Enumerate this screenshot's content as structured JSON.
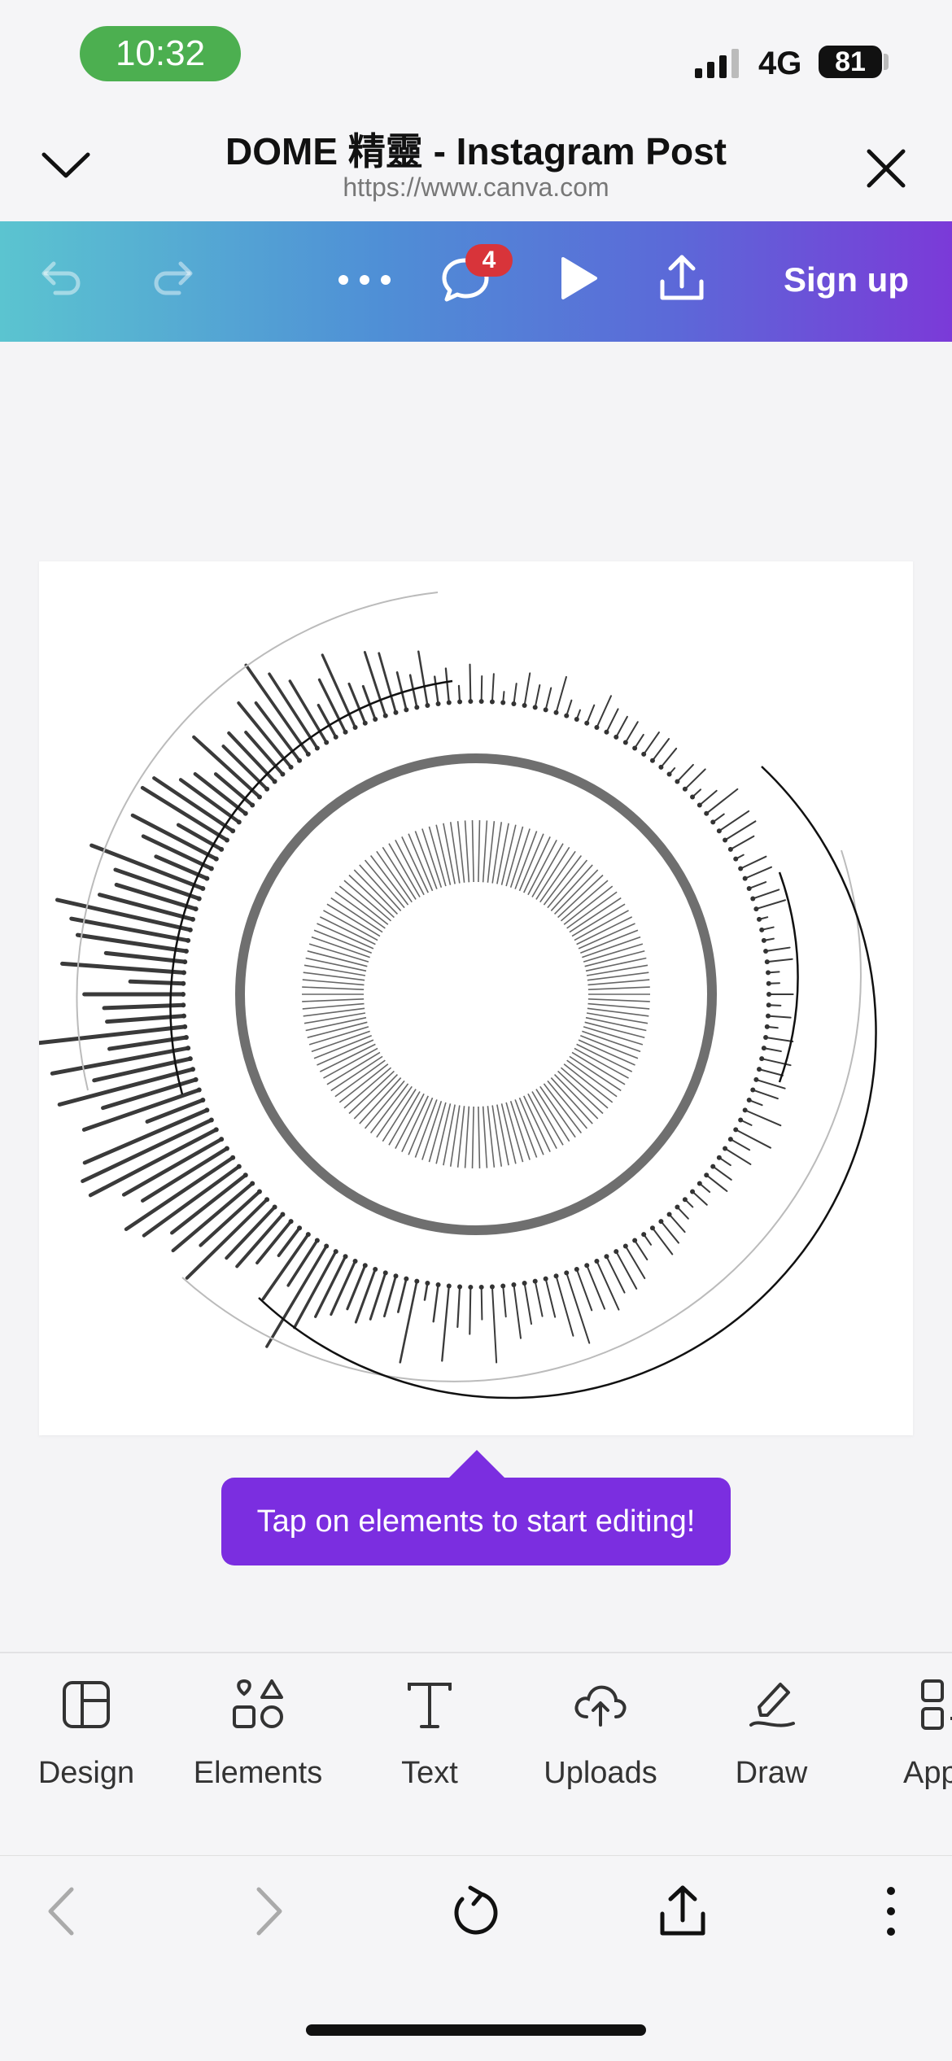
{
  "status_bar": {
    "time": "10:32",
    "network": "4G",
    "battery": "81"
  },
  "browser": {
    "title": "DOME 精靈 - Instagram Post",
    "url": "https://www.canva.com"
  },
  "toolbar": {
    "comments_count": "4",
    "signup_label": "Sign up"
  },
  "tooltip": {
    "text": "Tap on elements to start editing!"
  },
  "tools": [
    {
      "label": "Design",
      "icon": "design-layout-icon"
    },
    {
      "label": "Elements",
      "icon": "shapes-icon"
    },
    {
      "label": "Text",
      "icon": "text-icon"
    },
    {
      "label": "Uploads",
      "icon": "cloud-upload-icon"
    },
    {
      "label": "Draw",
      "icon": "pen-icon"
    },
    {
      "label": "App",
      "icon": "apps-grid-icon"
    }
  ],
  "colors": {
    "toolbar_start": "#5bc4d0",
    "toolbar_end": "#7b3ad8",
    "tooltip": "#7b2ee0",
    "badge": "#d8343a",
    "time_pill": "#4caf50"
  }
}
